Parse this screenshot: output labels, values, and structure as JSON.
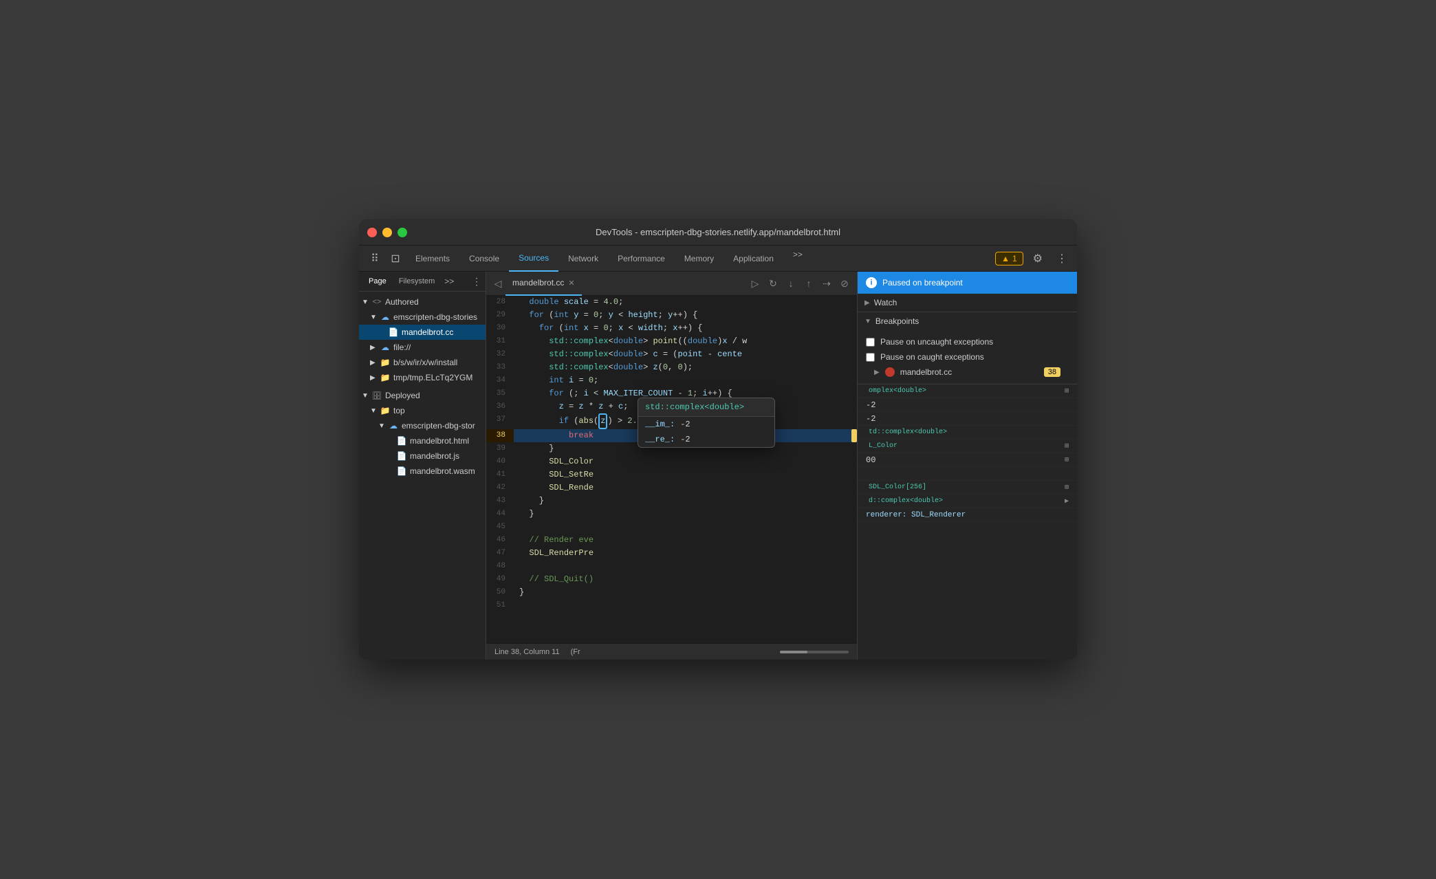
{
  "window": {
    "title": "DevTools - emscripten-dbg-stories.netlify.app/mandelbrot.html"
  },
  "titlebar": {
    "title": "DevTools - emscripten-dbg-stories.netlify.app/mandelbrot.html"
  },
  "tabs": {
    "items": [
      "Elements",
      "Console",
      "Sources",
      "Network",
      "Performance",
      "Memory",
      "Application"
    ],
    "active": "Sources",
    "more_label": ">>",
    "warning": "▲ 1"
  },
  "sidebar": {
    "tabs": [
      "Page",
      "Filesystem"
    ],
    "more": ">>",
    "tree": [
      {
        "level": 0,
        "type": "expand",
        "icon": "<>",
        "label": "Authored",
        "expanded": true
      },
      {
        "level": 1,
        "type": "expand",
        "icon": "☁",
        "label": "emscripten-dbg-stories",
        "expanded": true
      },
      {
        "level": 2,
        "type": "file",
        "icon": "📄",
        "label": "mandelbrot.cc",
        "selected": true
      },
      {
        "level": 1,
        "type": "expand",
        "icon": "☁",
        "label": "file://",
        "expanded": false
      },
      {
        "level": 1,
        "type": "folder",
        "icon": "📁",
        "label": "b/s/w/ir/x/w/install",
        "expanded": false
      },
      {
        "level": 1,
        "type": "folder",
        "icon": "📁",
        "label": "tmp/tmp.ELcTq2YGM",
        "expanded": false
      },
      {
        "level": 0,
        "type": "expand",
        "icon": "🗄",
        "label": "Deployed",
        "expanded": true
      },
      {
        "level": 1,
        "type": "expand",
        "icon": "📁",
        "label": "top",
        "expanded": true
      },
      {
        "level": 2,
        "type": "expand",
        "icon": "☁",
        "label": "emscripten-dbg-stor",
        "expanded": true
      },
      {
        "level": 3,
        "type": "file",
        "icon": "📄",
        "label": "mandelbrot.html"
      },
      {
        "level": 3,
        "type": "file",
        "icon": "📄",
        "label": "mandelbrot.js"
      },
      {
        "level": 3,
        "type": "file",
        "icon": "📄",
        "label": "mandelbrot.wasm"
      }
    ]
  },
  "code": {
    "filename": "mandelbrot.cc",
    "lines": [
      {
        "num": 28,
        "content": "  double scale = 4.0;",
        "highlighted": false
      },
      {
        "num": 29,
        "content": "  for (int y = 0; y < height; y++) {",
        "highlighted": false
      },
      {
        "num": 30,
        "content": "    for (int x = 0; x < width; x++) {",
        "highlighted": false
      },
      {
        "num": 31,
        "content": "      std::complex<double> point((double)x / w",
        "highlighted": false
      },
      {
        "num": 32,
        "content": "      std::complex<double> c = (point - cente",
        "highlighted": false
      },
      {
        "num": 33,
        "content": "      std::complex<double> z(0, 0);",
        "highlighted": false
      },
      {
        "num": 34,
        "content": "      int i = 0;",
        "highlighted": false
      },
      {
        "num": 35,
        "content": "      for (; i < MAX_ITER_COUNT - 1; i++) {",
        "highlighted": false
      },
      {
        "num": 36,
        "content": "        z = z * z + c;",
        "highlighted": false
      },
      {
        "num": 37,
        "content": "        if (abs([z]) > 2.0)",
        "highlighted": false
      },
      {
        "num": 38,
        "content": "          break",
        "highlighted": true,
        "breakpoint": true
      },
      {
        "num": 39,
        "content": "      }",
        "highlighted": false
      },
      {
        "num": 40,
        "content": "      SDL_Color",
        "highlighted": false
      },
      {
        "num": 41,
        "content": "      SDL_SetRe",
        "highlighted": false
      },
      {
        "num": 42,
        "content": "      SDL_Rende",
        "highlighted": false
      },
      {
        "num": 43,
        "content": "    }",
        "highlighted": false
      },
      {
        "num": 44,
        "content": "  }",
        "highlighted": false
      },
      {
        "num": 45,
        "content": "",
        "highlighted": false
      },
      {
        "num": 46,
        "content": "  // Render eve",
        "highlighted": false
      },
      {
        "num": 47,
        "content": "  SDL_RenderPre",
        "highlighted": false
      },
      {
        "num": 48,
        "content": "",
        "highlighted": false
      },
      {
        "num": 49,
        "content": "  // SDL_Quit()",
        "highlighted": false
      },
      {
        "num": 50,
        "content": "}",
        "highlighted": false
      },
      {
        "num": 51,
        "content": "",
        "highlighted": false
      }
    ],
    "status": {
      "position": "Line 38, Column 11",
      "frame": "(Fr"
    }
  },
  "tooltip": {
    "title": "std::complex<double>",
    "rows": [
      {
        "key": "__im_:",
        "val": "-2"
      },
      {
        "key": "__re_:",
        "val": "-2"
      }
    ]
  },
  "right_panel": {
    "paused_label": "Paused on breakpoint",
    "watch_label": "Watch",
    "breakpoints_label": "Breakpoints",
    "pause_uncaught_label": "Pause on uncaught exceptions",
    "pause_caught_label": "Pause on caught exceptions",
    "breakpoint_file": "mandelbrot.cc",
    "breakpoint_line": "38",
    "vars": [
      {
        "name": "",
        "type": "omplex<double>",
        "val": ""
      },
      {
        "name": "-2",
        "type": "",
        "val": ""
      },
      {
        "name": "-2",
        "type": "",
        "val": ""
      },
      {
        "name": "",
        "type": "td::complex<double>",
        "val": ""
      },
      {
        "name": "",
        "type": "L_Color",
        "val": ""
      },
      {
        "name": "00",
        "type": "",
        "val": ""
      },
      {
        "name": "",
        "type": "",
        "val": ""
      },
      {
        "name": "",
        "type": "SDL_Color[256]",
        "val": ""
      },
      {
        "name": "",
        "type": "d::complex<double>",
        "val": ""
      },
      {
        "name": "renderer: SDL_Renderer",
        "type": "",
        "val": ""
      }
    ]
  }
}
